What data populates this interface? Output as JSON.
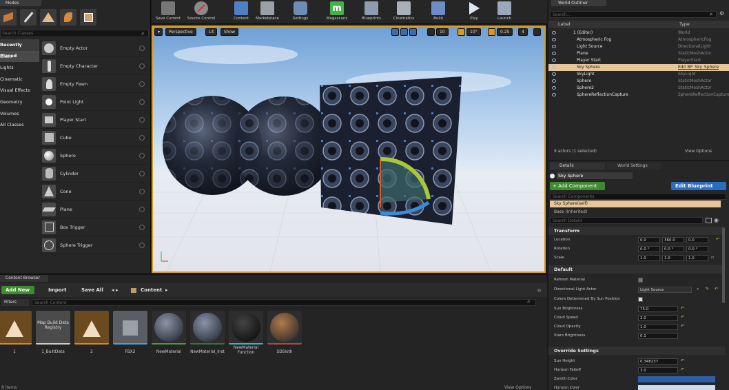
{
  "modes": {
    "tab": "Modes",
    "search_placeholder": "Search Classes",
    "categories": [
      "Recently Placed",
      "Basic",
      "Lights",
      "Cinematic",
      "Visual Effects",
      "Geometry",
      "Volumes",
      "All Classes"
    ],
    "selected_category": "Basic",
    "actors": [
      "Empty Actor",
      "Empty Character",
      "Empty Pawn",
      "Point Light",
      "Player Start",
      "Cube",
      "Sphere",
      "Cylinder",
      "Cone",
      "Plane",
      "Box Trigger",
      "Sphere Trigger"
    ]
  },
  "toolbar": {
    "buttons": [
      "Save Current",
      "Source Control",
      "Content",
      "Marketplace",
      "Settings",
      "Megascans",
      "Blueprints",
      "Cinematics",
      "Build",
      "Play",
      "Launch"
    ]
  },
  "viewport": {
    "perspective": "Perspective",
    "lit": "Lit",
    "show": "Show",
    "grid_snap": "10",
    "angle_snap": "10°",
    "scale_snap": "0.25",
    "camera_speed": "4"
  },
  "content_browser": {
    "tab": "Content Browser",
    "add_new": "Add New",
    "import": "Import",
    "save_all": "Save All",
    "path": "Content",
    "filters": "Filters",
    "search_placeholder": "Search Content",
    "status": "8 items",
    "view_options": "View Options",
    "assets": [
      {
        "name": "1",
        "thumb_text": ""
      },
      {
        "name": "1_BuiltData",
        "thumb_text": "Map Build Data Registry"
      },
      {
        "name": "2",
        "thumb_text": ""
      },
      {
        "name": "FBX2",
        "thumb_text": ""
      },
      {
        "name": "NewMaterial",
        "thumb_text": ""
      },
      {
        "name": "NewMaterial_Inst",
        "thumb_text": ""
      },
      {
        "name": "NewMaterial Function",
        "thumb_text": ""
      },
      {
        "name": "SDSloth",
        "thumb_text": ""
      }
    ]
  },
  "outliner": {
    "tab": "World Outliner",
    "search_placeholder": "Search...",
    "col_label": "Label",
    "col_type": "Type",
    "rows": [
      {
        "name": "1 (Editor)",
        "type": "World"
      },
      {
        "name": "Atmospheric Fog",
        "type": "AtmosphericFog"
      },
      {
        "name": "Light Source",
        "type": "DirectionalLight"
      },
      {
        "name": "Plane",
        "type": "StaticMeshActor"
      },
      {
        "name": "Player Start",
        "type": "PlayerStart"
      },
      {
        "name": "Sky Sphere",
        "type": "Edit BP_Sky_Sphere",
        "selected": true
      },
      {
        "name": "SkyLight",
        "type": "SkyLight"
      },
      {
        "name": "Sphere",
        "type": "StaticMeshActor"
      },
      {
        "name": "Sphere2",
        "type": "StaticMeshActor"
      },
      {
        "name": "SphereReflectionCapture",
        "type": "SphereReflectionCapture"
      }
    ],
    "count": "9 actors (1 selected)",
    "view_options": "View Options"
  },
  "details": {
    "tab": "Details",
    "world_settings_tab": "World Settings",
    "object_name": "Sky Sphere",
    "add_component": "+ Add Component",
    "edit_blueprint": "Edit Blueprint",
    "search_components": "Search Components",
    "self_row": "Sky Sphere(self)",
    "base_row": "Base (Inherited)",
    "search_details": "Search Details",
    "transform_header": "Transform",
    "location_label": "Location",
    "location": [
      "0.0",
      "360.0",
      "0.0"
    ],
    "rotation_label": "Rotation",
    "rotation": [
      "0.0 °",
      "0.0 °",
      "0.0 °"
    ],
    "scale_label": "Scale",
    "scale": [
      "1.0",
      "1.0",
      "1.0"
    ],
    "default_header": "Default",
    "refresh_material": "Refresh Material",
    "directional_light_actor": "Directional Light Actor",
    "directional_light_value": "Light Source",
    "colors_by_sun": "Colors Determined By Sun Position",
    "sun_brightness_label": "Sun Brightness",
    "sun_brightness": "75.0",
    "cloud_speed_label": "Cloud Speed",
    "cloud_speed": "2.0",
    "cloud_opacity_label": "Cloud Opacity",
    "cloud_opacity": "1.0",
    "stars_brightness_label": "Stars Brightness",
    "stars_brightness": "0.1",
    "override_header": "Override Settings",
    "sun_height_label": "Sun Height",
    "sun_height": "0.348237",
    "horizon_falloff_label": "Horizon Falloff",
    "horizon_falloff": "3.0",
    "zenith_color_label": "Zenith Color",
    "horizon_color_label": "Horizon Color"
  },
  "colors": {
    "accent_green": "#3d8c2d",
    "accent_blue": "#2a6bc4",
    "selection": "#e7c79a",
    "viewport_border": "#d69a1e"
  }
}
